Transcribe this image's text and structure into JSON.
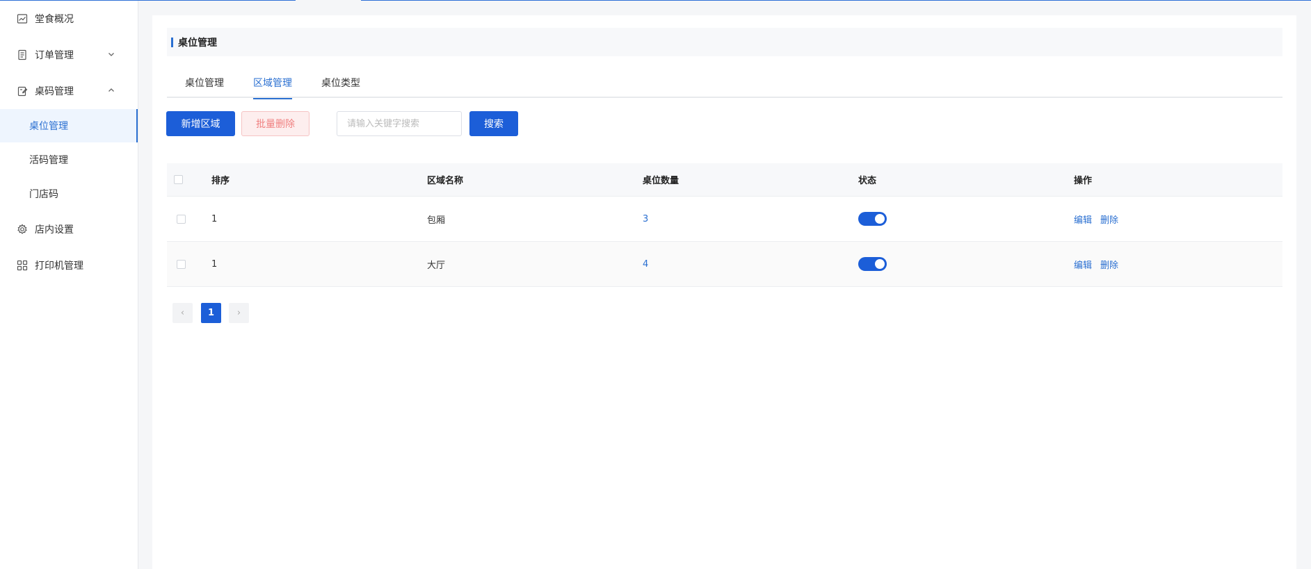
{
  "sidebar": {
    "items": [
      {
        "label": "堂食概况",
        "icon": "chart-line-icon"
      },
      {
        "label": "订单管理",
        "icon": "document-icon",
        "expanded": false
      },
      {
        "label": "桌码管理",
        "icon": "clipboard-edit-icon",
        "expanded": true
      },
      {
        "label": "店内设置",
        "icon": "gear-icon"
      },
      {
        "label": "打印机管理",
        "icon": "grid-apps-icon"
      }
    ],
    "sub_items": [
      {
        "label": "桌位管理",
        "active": true
      },
      {
        "label": "活码管理"
      },
      {
        "label": "门店码"
      }
    ]
  },
  "page": {
    "title": "桌位管理"
  },
  "tabs": [
    {
      "label": "桌位管理"
    },
    {
      "label": "区域管理",
      "active": true
    },
    {
      "label": "桌位类型"
    }
  ],
  "toolbar": {
    "add_label": "新增区域",
    "batch_delete_label": "批量删除",
    "search_placeholder": "请输入关键字搜索",
    "search_label": "搜索"
  },
  "table": {
    "columns": [
      "排序",
      "区域名称",
      "桌位数量",
      "状态",
      "操作"
    ],
    "rows": [
      {
        "order": "1",
        "name": "包厢",
        "count": "3",
        "status": true
      },
      {
        "order": "1",
        "name": "大厅",
        "count": "4",
        "status": true
      }
    ],
    "actions": {
      "edit": "编辑",
      "delete": "删除"
    }
  },
  "pagination": {
    "current": "1",
    "prev": "‹",
    "next": "›"
  },
  "colors": {
    "primary": "#1c5ed8",
    "link": "#2a6fd1",
    "danger_light_bg": "#fdeeee",
    "danger_text": "#f08080"
  }
}
